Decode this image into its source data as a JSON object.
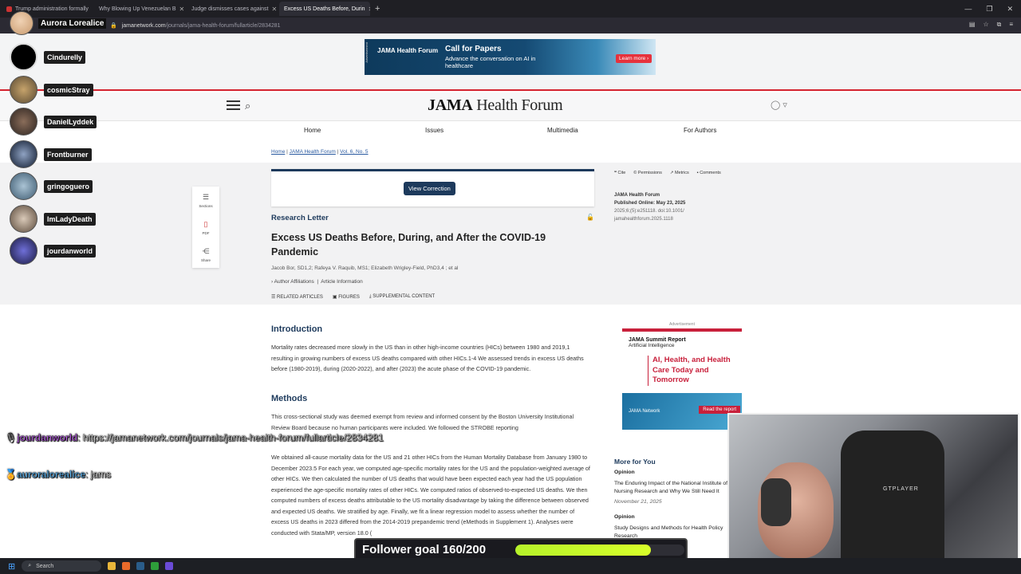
{
  "browser": {
    "tabs": [
      {
        "label": "Trump administration formally",
        "active": false
      },
      {
        "label": "Why Blowing Up Venezuelan B",
        "active": false
      },
      {
        "label": "Judge dismisses cases against",
        "active": false
      },
      {
        "label": "Excess US Deaths Before, Durin",
        "active": true
      }
    ],
    "url_host": "jamanetwork.com",
    "url_path": "/journals/jama-health-forum/fullarticle/2834281"
  },
  "ad": {
    "side_label": "Advertisement",
    "brand": "JAMA Health Forum",
    "title": "Call for Papers",
    "subtitle": "Advance the conversation on AI in healthcare",
    "cta": "Learn more ›"
  },
  "header": {
    "logo_main": "JAMA",
    "logo_rest": " Health Forum",
    "nav": [
      "Home",
      "Issues",
      "Multimedia",
      "For Authors"
    ]
  },
  "breadcrumb": [
    "Home",
    "JAMA Health Forum",
    "Vol. 6, No. 5"
  ],
  "correction_button": "View Correction",
  "sidetools": [
    "Sections",
    "PDF",
    "Share"
  ],
  "article": {
    "type": "Research Letter",
    "title": "Excess US Deaths Before, During, and After the COVID-19 Pandemic",
    "authors": "Jacob Bor, SD1,2; Rafeya V. Raquib, MS1; Elizabeth Wrigley-Field, PhD3,4 ; et al",
    "affiliations": "Author Affiliations",
    "article_info": "Article Information",
    "tools": [
      "RELATED ARTICLES",
      "FIGURES",
      "SUPPLEMENTAL CONTENT"
    ]
  },
  "meta_tabs": [
    "Cite",
    "Permissions",
    "Metrics",
    "Comments"
  ],
  "publication": {
    "journal": "JAMA Health Forum",
    "date": "Published Online: May 23, 2025",
    "citation1": "2025;6;(5):e251118. doi:10.1001/",
    "citation2": "jamahealthforum.2025.1118"
  },
  "sections": {
    "intro_heading": "Introduction",
    "intro_text": "Mortality rates decreased more slowly in the US than in other high-income countries (HICs) between 1980 and 2019,1 resulting in growing numbers of excess US deaths compared with other HICs.1-4 We assessed trends in excess US deaths before (1980-2019), during (2020-2022), and after (2023) the acute phase of the COVID-19 pandemic.",
    "methods_heading": "Methods",
    "methods_text1": "This cross-sectional study was deemed exempt from review and informed consent by the Boston University Institutional Review Board because no human participants were included. We followed the STROBE reporting",
    "methods_text2": "We obtained all-cause mortality data for the US and 21 other HICs from the Human Mortality Database from January 1980 to December 2023.5 For each year, we computed age-specific mortality rates for the US and the population-weighted average of other HICs. We then calculated the number of US deaths that would have been expected each year had the US population experienced the age-specific mortality rates of other HICs. We computed ratios of observed-to-expected US deaths. We then computed numbers of excess deaths attributable to the US mortality disadvantage by taking the difference between observed and expected US deaths. We stratified by age. Finally, we fit a linear regression model to assess whether the number of excess US deaths in 2023 differed from the 2014-2019 prepandemic trend (eMethods in Supplement 1). Analyses were conducted with Stata/MP, version 18.0 ("
  },
  "right_ad": {
    "label": "Advertisement",
    "report": "JAMA Summit Report",
    "topic": "Artificial Intelligence",
    "headline": "AI, Health, and Health Care Today and Tomorrow",
    "network": "JAMA Network",
    "cta": "Read the report"
  },
  "more_for_you": {
    "heading": "More for You",
    "items": [
      {
        "kind": "Opinion",
        "title": "The Enduring Impact of the National Institute of Nursing Research and Why We Still Need It",
        "date": "November 21, 2025"
      },
      {
        "kind": "Opinion",
        "title": "Study Designs and Methods for Health Policy Research",
        "date": ""
      }
    ]
  },
  "stream": {
    "streamer": "Aurora Lorealice",
    "viewers": [
      "Cindurelly",
      "cosmicStray",
      "DanielLyddek",
      "Frontburner",
      "gringoguero",
      "ImLadyDeath",
      "jourdanworld"
    ],
    "chat": [
      {
        "user": "jourdanworld",
        "msg": " https://jamanetwork.com/journals/jama-health-forum/fullarticle/2834281"
      },
      {
        "user": "auroralorealice",
        "msg": " jams"
      }
    ],
    "goal_label": "Follower goal 160/200",
    "goal_fraction": 0.8,
    "chair_brand": "GTPLAYER"
  },
  "taskbar": {
    "search": "Search"
  }
}
